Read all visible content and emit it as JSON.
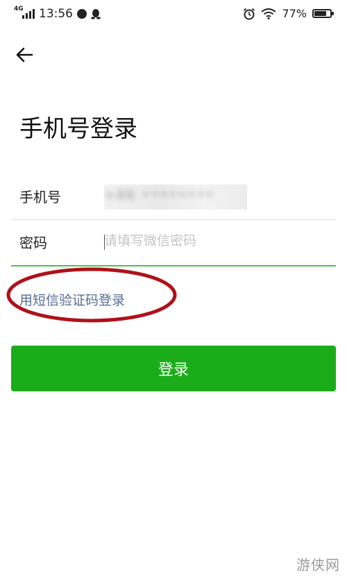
{
  "status_bar": {
    "network": "4G",
    "time": "13:56",
    "battery_percent": "77%",
    "battery_level": 0.77,
    "icons": [
      "signal-icon",
      "chat-bubble-icon",
      "qq-penguin-icon",
      "alarm-icon",
      "wifi-icon",
      "battery-icon"
    ]
  },
  "header": {
    "back_icon": "arrow-left-icon"
  },
  "page": {
    "title": "手机号登录"
  },
  "form": {
    "phone_label": "手机号",
    "phone_value": "+86 ••••••••",
    "password_label": "密码",
    "password_placeholder": "请填写微信密码"
  },
  "sms_login_link": "用短信验证码登录",
  "login_button": "登录",
  "watermark": "游侠网",
  "colors": {
    "primary_green": "#1aad19",
    "link_blue": "#576b95",
    "annotation_red": "#b0101a",
    "focus_underline": "#4fbf4f"
  }
}
